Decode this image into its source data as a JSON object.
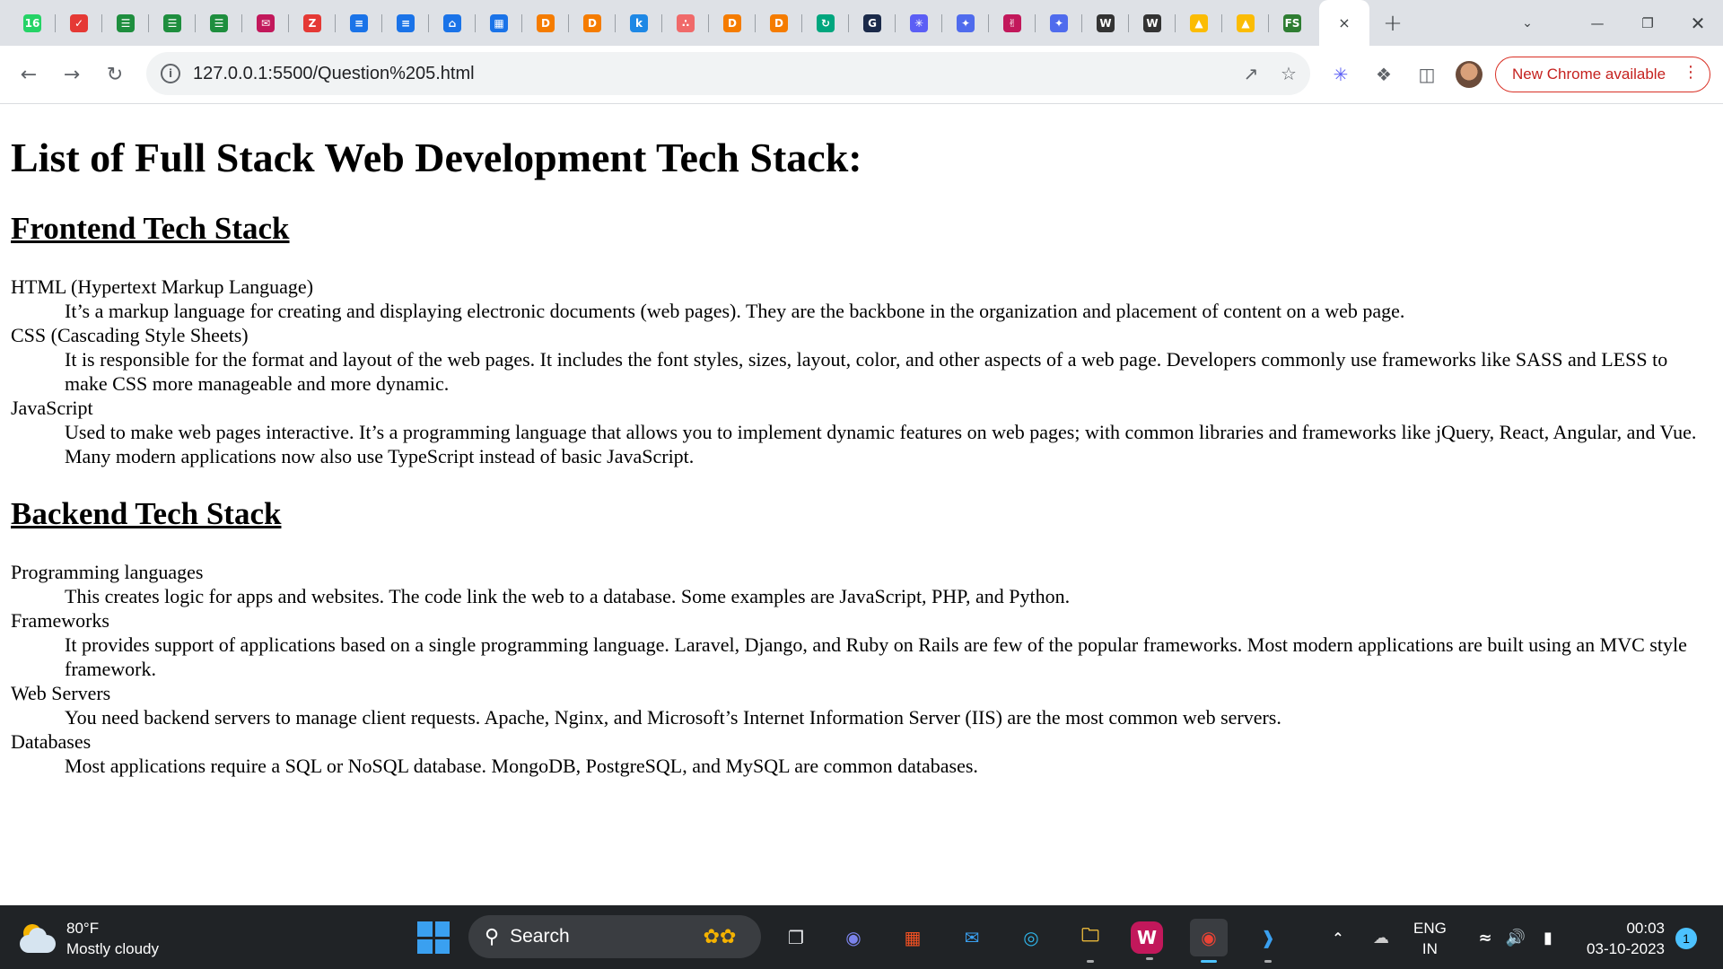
{
  "browser": {
    "tabs": [
      {
        "icon": "whatsapp-badge-icon",
        "glyph": "16",
        "color": "#25d366"
      },
      {
        "icon": "red-swirl-icon",
        "glyph": "✓",
        "color": "#e53935"
      },
      {
        "icon": "green-form-icon",
        "glyph": "☰",
        "color": "#1e8e3e"
      },
      {
        "icon": "green-form-icon",
        "glyph": "☰",
        "color": "#1e8e3e"
      },
      {
        "icon": "green-form-icon",
        "glyph": "☰",
        "color": "#1e8e3e"
      },
      {
        "icon": "chat-icon",
        "glyph": "✉",
        "color": "#c2185b"
      },
      {
        "icon": "zoho-z-icon",
        "glyph": "Z",
        "color": "#e53935"
      },
      {
        "icon": "doc-icon",
        "glyph": "≡",
        "color": "#1a73e8"
      },
      {
        "icon": "doc-icon",
        "glyph": "≡",
        "color": "#1a73e8"
      },
      {
        "icon": "inbox-icon",
        "glyph": "⌂",
        "color": "#1a73e8"
      },
      {
        "icon": "assessment-icon",
        "glyph": "▦",
        "color": "#1a73e8"
      },
      {
        "icon": "d-icon",
        "glyph": "D",
        "color": "#f57c00"
      },
      {
        "icon": "d-icon",
        "glyph": "D",
        "color": "#f57c00"
      },
      {
        "icon": "k-icon",
        "glyph": "k",
        "color": "#1e88e5"
      },
      {
        "icon": "asana-icon",
        "glyph": "∴",
        "color": "#f06a6a"
      },
      {
        "icon": "d-icon",
        "glyph": "D",
        "color": "#f57c00"
      },
      {
        "icon": "d-icon",
        "glyph": "D",
        "color": "#f57c00"
      },
      {
        "icon": "green-arrow-icon",
        "glyph": "↻",
        "color": "#00a67e"
      },
      {
        "icon": "g-icon",
        "glyph": "G",
        "color": "#1b2a4a"
      },
      {
        "icon": "flower-icon",
        "glyph": "✳",
        "color": "#5b5ef5"
      },
      {
        "icon": "sparkle-icon",
        "glyph": "✦",
        "color": "#4f6bed"
      },
      {
        "icon": "hand-icon",
        "glyph": "✌",
        "color": "#c2185b"
      },
      {
        "icon": "sparkle-icon",
        "glyph": "✦",
        "color": "#4f6bed"
      },
      {
        "icon": "wordpress-icon",
        "glyph": "W",
        "color": "#333333"
      },
      {
        "icon": "wordpress-icon",
        "glyph": "W",
        "color": "#333333"
      },
      {
        "icon": "drive-icon",
        "glyph": "▲",
        "color": "#fbbc04"
      },
      {
        "icon": "drive-icon",
        "glyph": "▲",
        "color": "#fbbc04"
      },
      {
        "icon": "fs-icon",
        "glyph": "FS",
        "color": "#2e7d32"
      }
    ],
    "active_tab_close": "×",
    "new_tab": "+",
    "url": "127.0.0.1:5500/Question%205.html",
    "update_label": "New Chrome available"
  },
  "page": {
    "title": "List of Full Stack Web Development Tech Stack:",
    "sections": [
      {
        "heading": "Frontend Tech Stack",
        "items": [
          {
            "term": "HTML (Hypertext Markup Language)",
            "desc": "It’s a markup language for creating and displaying electronic documents (web pages). They are the backbone in the organization and placement of content on a web page."
          },
          {
            "term": "CSS (Cascading Style Sheets)",
            "desc": "It is responsible for the format and layout of the web pages. It includes the font styles, sizes, layout, color, and other aspects of a web page. Developers commonly use frameworks like SASS and LESS to make CSS more manageable and more dynamic."
          },
          {
            "term": "JavaScript",
            "desc": "Used to make web pages interactive. It’s a programming language that allows you to implement dynamic features on web pages; with common libraries and frameworks like jQuery, React, Angular, and Vue. Many modern applications now also use TypeScript instead of basic JavaScript."
          }
        ]
      },
      {
        "heading": "Backend Tech Stack",
        "items": [
          {
            "term": "Programming languages",
            "desc": "This creates logic for apps and websites. The code link the web to a database. Some examples are JavaScript, PHP, and Python."
          },
          {
            "term": "Frameworks",
            "desc": "It provides support of applications based on a single programming language. Laravel, Django, and Ruby on Rails are few of the popular frameworks. Most modern applications are built using an MVC style framework."
          },
          {
            "term": "Web Servers",
            "desc": "You need backend servers to manage client requests. Apache, Nginx, and Microsoft’s Internet Information Server (IIS) are the most common web servers."
          },
          {
            "term": "Databases",
            "desc": "Most applications require a SQL or NoSQL database. MongoDB, PostgreSQL, and MySQL are common databases."
          }
        ]
      }
    ]
  },
  "taskbar": {
    "weather_temp": "80°F",
    "weather_desc": "Mostly cloudy",
    "search_placeholder": "Search",
    "lang_line1": "ENG",
    "lang_line2": "IN",
    "time": "00:03",
    "date": "03-10-2023",
    "notifications": "1"
  }
}
